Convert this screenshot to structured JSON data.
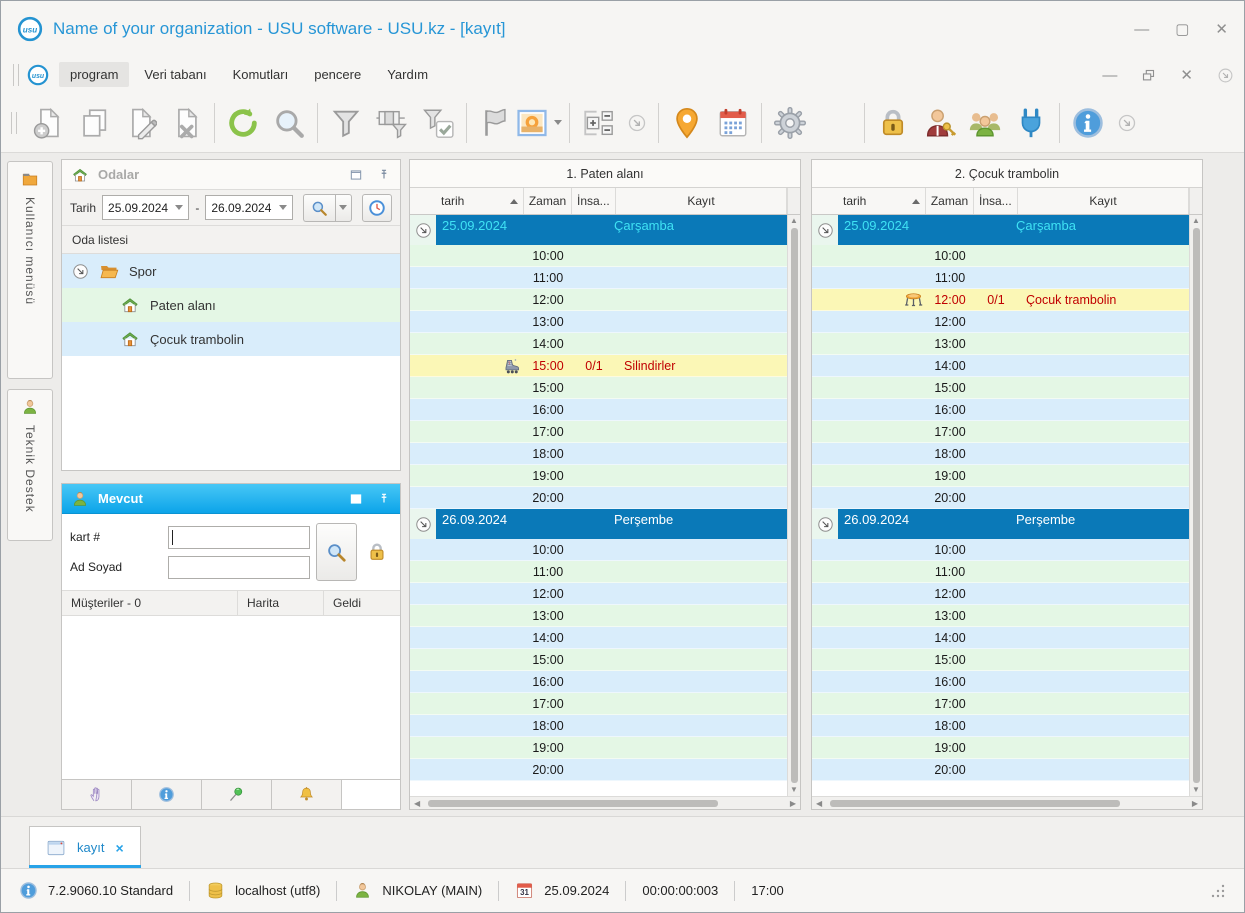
{
  "window": {
    "title": "Name of your organization - USU software - USU.kz - [kayıt]",
    "controls": [
      "minimize",
      "maximize",
      "close"
    ],
    "mdi_controls": [
      "minimize",
      "restore",
      "close",
      "overflow"
    ]
  },
  "menu": {
    "items": [
      "program",
      "Veri tabanı",
      "Komutları",
      "pencere",
      "Yardım"
    ],
    "active": "program"
  },
  "toolbar": {
    "groups": [
      [
        "add-record",
        "copy-record",
        "edit-record",
        "delete-record"
      ],
      [
        "refresh",
        "search"
      ],
      [
        "filter",
        "filter-columns",
        "filter-check"
      ],
      [
        "flag",
        "picture"
      ],
      [
        "row-expand",
        "overflow-chevron"
      ],
      [
        "location",
        "calendar"
      ],
      [
        "settings",
        "color-wheel"
      ],
      [
        "lock",
        "user-key",
        "users-group",
        "plug"
      ],
      [
        "info",
        "overflow-chevron"
      ]
    ]
  },
  "side_tabs": [
    {
      "label": "Kullanıcı menüsü",
      "icon": "folder"
    },
    {
      "label": "Teknik Destek",
      "icon": "person"
    }
  ],
  "odalar": {
    "title": "Odalar",
    "date_label": "Tarih",
    "date_from": "25.09.2024",
    "date_to": "26.09.2024",
    "range_dash": "-",
    "list_header": "Oda listesi",
    "tree": [
      {
        "label": "Spor",
        "icon": "folder-open",
        "level": 0,
        "stripe": "blue",
        "expander": true
      },
      {
        "label": "Paten alanı",
        "icon": "house",
        "level": 1,
        "stripe": "green",
        "expander": false
      },
      {
        "label": "Çocuk trambolin",
        "icon": "house",
        "level": 1,
        "stripe": "blue",
        "expander": false
      }
    ]
  },
  "mevcut": {
    "title": "Mevcut",
    "card_label": "kart #",
    "card_value": "",
    "name_label": "Ad Soyad",
    "name_value": "",
    "table_headers": [
      "Müşteriler - 0",
      "Harita",
      "Geldi"
    ],
    "buttons": [
      "hand",
      "info",
      "pushpin",
      "bell"
    ]
  },
  "schedule": {
    "columns": {
      "date": "tarih",
      "time": "Zaman",
      "people": "İnsa...",
      "record": "Kayıt"
    },
    "sort_column": "tarih",
    "sort_direction": "asc",
    "panels": [
      {
        "caption": "1. Paten alanı",
        "sections": [
          {
            "date": "25.09.2024",
            "weekday": "Çarşamba",
            "active": true,
            "rows": [
              "10:00",
              "11:00",
              "12:00",
              "13:00",
              "14:00",
              {
                "time": "15:00",
                "people": "0/1",
                "record": "Silindirler",
                "icon": "skate"
              },
              "15:00",
              "16:00",
              "17:00",
              "18:00",
              "19:00",
              "20:00"
            ]
          },
          {
            "date": "26.09.2024",
            "weekday": "Perşembe",
            "active": false,
            "rows": [
              "10:00",
              "11:00",
              "12:00",
              "13:00",
              "14:00",
              "15:00",
              "16:00",
              "17:00",
              "18:00",
              "19:00",
              "20:00"
            ]
          }
        ]
      },
      {
        "caption": "2. Çocuk trambolin",
        "sections": [
          {
            "date": "25.09.2024",
            "weekday": "Çarşamba",
            "active": true,
            "rows": [
              "10:00",
              "11:00",
              {
                "time": "12:00",
                "people": "0/1",
                "record": "Çocuk trambolin",
                "icon": "trampoline"
              },
              "12:00",
              "13:00",
              "14:00",
              "15:00",
              "16:00",
              "17:00",
              "18:00",
              "19:00",
              "20:00"
            ]
          },
          {
            "date": "26.09.2024",
            "weekday": "Perşembe",
            "active": false,
            "rows": [
              "10:00",
              "11:00",
              "12:00",
              "13:00",
              "14:00",
              "15:00",
              "16:00",
              "17:00",
              "18:00",
              "19:00",
              "20:00"
            ]
          }
        ]
      }
    ]
  },
  "footer_tab": {
    "label": "kayıt",
    "close": "×"
  },
  "status_bar": {
    "items": [
      {
        "icon": "info",
        "text": "7.2.9060.10 Standard"
      },
      {
        "icon": "db",
        "text": "localhost (utf8)"
      },
      {
        "icon": "person",
        "text": "NIKOLAY (MAIN)"
      },
      {
        "icon": "calendar-31",
        "text": "25.09.2024"
      },
      {
        "icon": null,
        "text": "00:00:00:003"
      },
      {
        "icon": null,
        "text": "17:00"
      }
    ]
  },
  "colors": {
    "accent_blue": "#2796d6",
    "day_header_bg": "#0a79b8",
    "day_header_text_active": "#3fe2f4",
    "day_header_text": "#ffffff",
    "row_green": "#e4f7e5",
    "row_blue": "#d9edfb",
    "booked_bg": "#fbf7b6",
    "booked_text": "#c00000",
    "mevcut_header": "#0ca4e9"
  }
}
